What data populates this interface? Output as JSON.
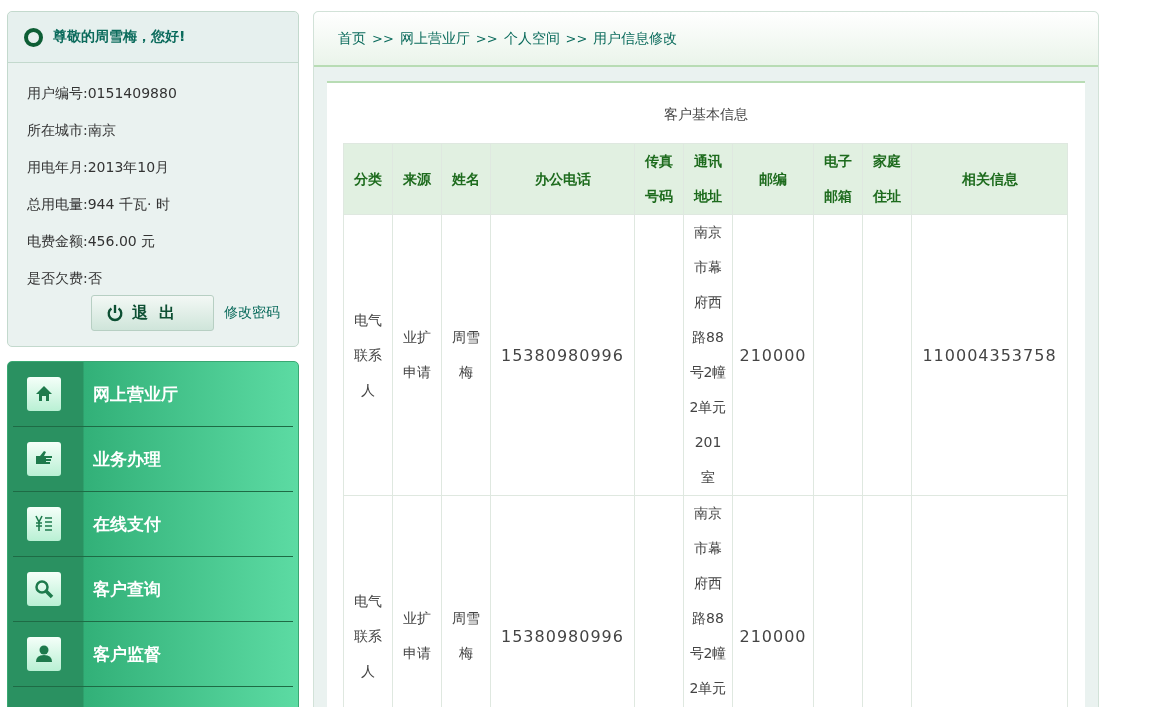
{
  "user_panel": {
    "greeting": "尊敬的周雪梅，您好!",
    "info": [
      "用户编号:0151409880",
      "所在城市:南京",
      "用电年月:2013年10月",
      "总用电量:944 千瓦· 时",
      "电费金额:456.00 元",
      "是否欠费:否"
    ],
    "logout_button": "退  出",
    "change_password_link": "修改密码"
  },
  "menu": [
    {
      "label": "网上营业厅"
    },
    {
      "label": "业务办理"
    },
    {
      "label": "在线支付"
    },
    {
      "label": "客户查询"
    },
    {
      "label": "客户监督"
    }
  ],
  "breadcrumb": [
    "首页",
    "网上营业厅",
    "个人空间",
    "用户信息修改"
  ],
  "breadcrumb_separator": ">>",
  "section_title": "客户基本信息",
  "table": {
    "columns": [
      "分类",
      "来源",
      "姓名",
      "办公电话",
      "传真号码",
      "通讯地址",
      "邮编",
      "电子邮箱",
      "家庭住址",
      "相关信息"
    ],
    "rows": [
      {
        "cells": [
          "电气联系人",
          "业扩申请",
          "周雪梅",
          "15380980996",
          null,
          "南京市幕府西路88号2幢2单元201室",
          "210000",
          null,
          null,
          "110004353758"
        ]
      },
      {
        "cells": [
          "电气联系人",
          "业扩申请",
          "周雪梅",
          "15380980996",
          null,
          "南京市幕府西路88号2幢2单元",
          "210000",
          null,
          null,
          null
        ]
      }
    ]
  }
}
